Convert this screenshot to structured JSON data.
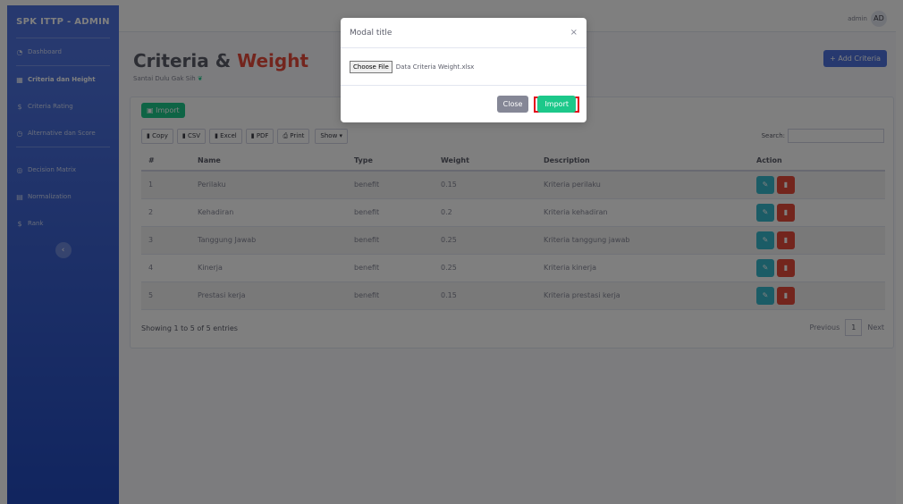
{
  "sidebar": {
    "brand": "SPK ITTP - ADMIN",
    "items": [
      {
        "icon": "dashboard-icon",
        "glyph": "◔",
        "label": "Dashboard"
      },
      {
        "icon": "table-icon",
        "glyph": "▦",
        "label": "Criteria dan Height"
      },
      {
        "icon": "dollar-icon",
        "glyph": "$",
        "label": "Criteria Rating"
      },
      {
        "icon": "clock-icon",
        "glyph": "◷",
        "label": "Alternative dan Score"
      },
      {
        "icon": "matrix-icon",
        "glyph": "◎",
        "label": "Decision Matrix"
      },
      {
        "icon": "grid-icon",
        "glyph": "▤",
        "label": "Normalization"
      },
      {
        "icon": "rank-icon",
        "glyph": "$",
        "label": "Rank"
      }
    ],
    "toggle_glyph": "‹"
  },
  "topbar": {
    "user_name": "admin",
    "avatar_initials": "AD"
  },
  "page": {
    "title_part1": "Criteria",
    "title_amp": "&",
    "title_part2": "Weight",
    "subtitle": "Santai Dulu Gak Sih",
    "add_button": "+ Add Criteria",
    "import_button": "Import"
  },
  "toolbar": {
    "copy": "Copy",
    "csv": "CSV",
    "excel": "Excel",
    "pdf": "PDF",
    "print": "Print",
    "show": "Show ▾",
    "search_label": "Search:"
  },
  "table": {
    "headers": [
      "#",
      "Name",
      "Type",
      "Weight",
      "Description",
      "Action"
    ],
    "rows": [
      [
        "1",
        "Perilaku",
        "benefit",
        "0.15",
        "Kriteria perilaku"
      ],
      [
        "2",
        "Kehadiran",
        "benefit",
        "0.2",
        "Kriteria kehadiran"
      ],
      [
        "3",
        "Tanggung Jawab",
        "benefit",
        "0.25",
        "Kriteria tanggung jawab"
      ],
      [
        "4",
        "Kinerja",
        "benefit",
        "0.25",
        "Kriteria kinerja"
      ],
      [
        "5",
        "Prestasi kerja",
        "benefit",
        "0.15",
        "Kriteria prestasi kerja"
      ]
    ]
  },
  "footer": {
    "entries": "Showing 1 to 5 of 5 entries",
    "previous": "Previous",
    "page": "1",
    "next": "Next"
  },
  "modal": {
    "title": "Modal title",
    "close_x": "×",
    "choose_file": "Choose File",
    "file_name": "Data Criteria Weight.xlsx",
    "close_button": "Close",
    "import_button": "Import"
  },
  "colors": {
    "primary": "#4e73df",
    "success": "#1cc88a",
    "danger": "#e74a3b",
    "info": "#36b9cc",
    "highlight": "#e3001b"
  }
}
